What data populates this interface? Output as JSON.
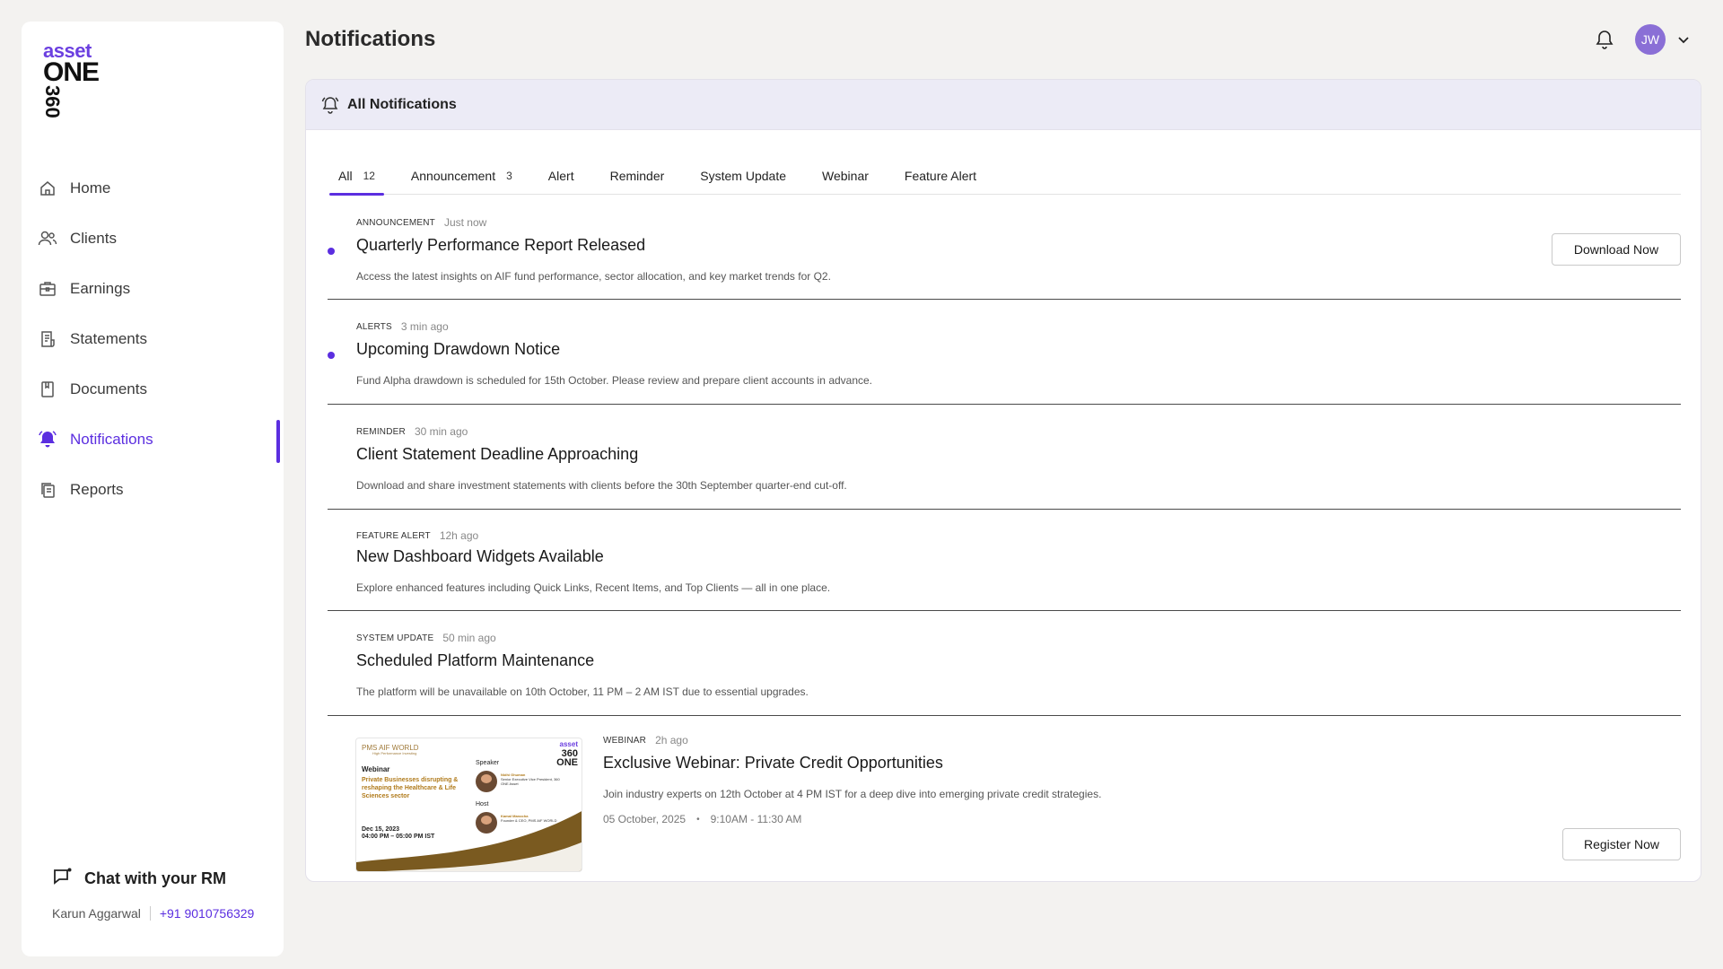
{
  "brand": {
    "line1": "asset",
    "line2": "ONE",
    "line3": "360"
  },
  "sidebar": {
    "items": [
      {
        "label": "Home",
        "icon": "home-icon"
      },
      {
        "label": "Clients",
        "icon": "users-icon"
      },
      {
        "label": "Earnings",
        "icon": "briefcase-icon"
      },
      {
        "label": "Statements",
        "icon": "receipt-icon"
      },
      {
        "label": "Documents",
        "icon": "document-icon"
      },
      {
        "label": "Notifications",
        "icon": "bell-icon",
        "active": true
      },
      {
        "label": "Reports",
        "icon": "reports-icon"
      }
    ],
    "chat": {
      "title": "Chat with your RM",
      "rm_name": "Karun Aggarwal",
      "rm_phone": "+91 9010756329"
    }
  },
  "header": {
    "title": "Notifications",
    "avatar_initials": "JW"
  },
  "panel": {
    "title": "All Notifications",
    "tabs": [
      {
        "label": "All",
        "count": "12",
        "active": true
      },
      {
        "label": "Announcement",
        "count": "3"
      },
      {
        "label": "Alert"
      },
      {
        "label": "Reminder"
      },
      {
        "label": "System Update"
      },
      {
        "label": "Webinar"
      },
      {
        "label": "Feature Alert"
      }
    ],
    "notifications": [
      {
        "tag": "Announcement",
        "time": "Just now",
        "title": "Quarterly Performance Report Released",
        "desc": "Access the latest insights on AIF fund performance, sector allocation, and key market trends for Q2.",
        "unread": true,
        "action": "Download Now"
      },
      {
        "tag": "Alerts",
        "time": "3 min ago",
        "title": "Upcoming Drawdown Notice",
        "desc": "Fund Alpha drawdown is scheduled for 15th October. Please review and prepare client accounts in advance.",
        "unread": true
      },
      {
        "tag": "Reminder",
        "time": "30 min ago",
        "title": "Client Statement Deadline Approaching",
        "desc": "Download and share investment statements with clients before the 30th September quarter-end cut-off."
      },
      {
        "tag": "Feature Alert",
        "time": "12h ago",
        "title": "New Dashboard Widgets Available",
        "desc": "Explore enhanced features including Quick Links, Recent Items, and Top Clients — all in one place."
      },
      {
        "tag": "System Update",
        "time": "50 min ago",
        "title": "Scheduled Platform Maintenance",
        "desc": "The platform will be unavailable on 10th October, 11 PM – 2 AM IST due to essential upgrades."
      }
    ],
    "webinar": {
      "tag": "Webinar",
      "time": "2h ago",
      "title": "Exclusive Webinar: Private Credit Opportunities",
      "desc": "Join industry experts on 12th October at 4 PM IST for a deep dive into emerging private credit strategies.",
      "date": "05 October, 2025",
      "slot": "9:10AM - 11:30 AM",
      "action": "Register Now",
      "thumbnail": {
        "brand": "PMS AIF WORLD",
        "brand_sub": "High Performance Investing",
        "logo_top": "asset",
        "logo_mid": "360",
        "logo_bottom": "ONE",
        "label": "Webinar",
        "title": "Private Businesses disrupting & reshaping the Healthcare & Life Sciences sector",
        "date_line": "Dec 15, 2023",
        "time_line": "04:00 PM – 05:00 PM IST",
        "speaker_label": "Speaker",
        "speaker_name": "Nidhi Ghuman",
        "speaker_role": "Senior Executive Vice President, 360 ONE Asset",
        "host_label": "Host",
        "host_name": "Kamal Manocha",
        "host_role": "Founder & CEO, PMS AIF WORLD"
      }
    }
  },
  "colors": {
    "accent": "#5b2ee0",
    "header_bg": "#ecebf6",
    "page_bg": "#f3f2f0"
  }
}
